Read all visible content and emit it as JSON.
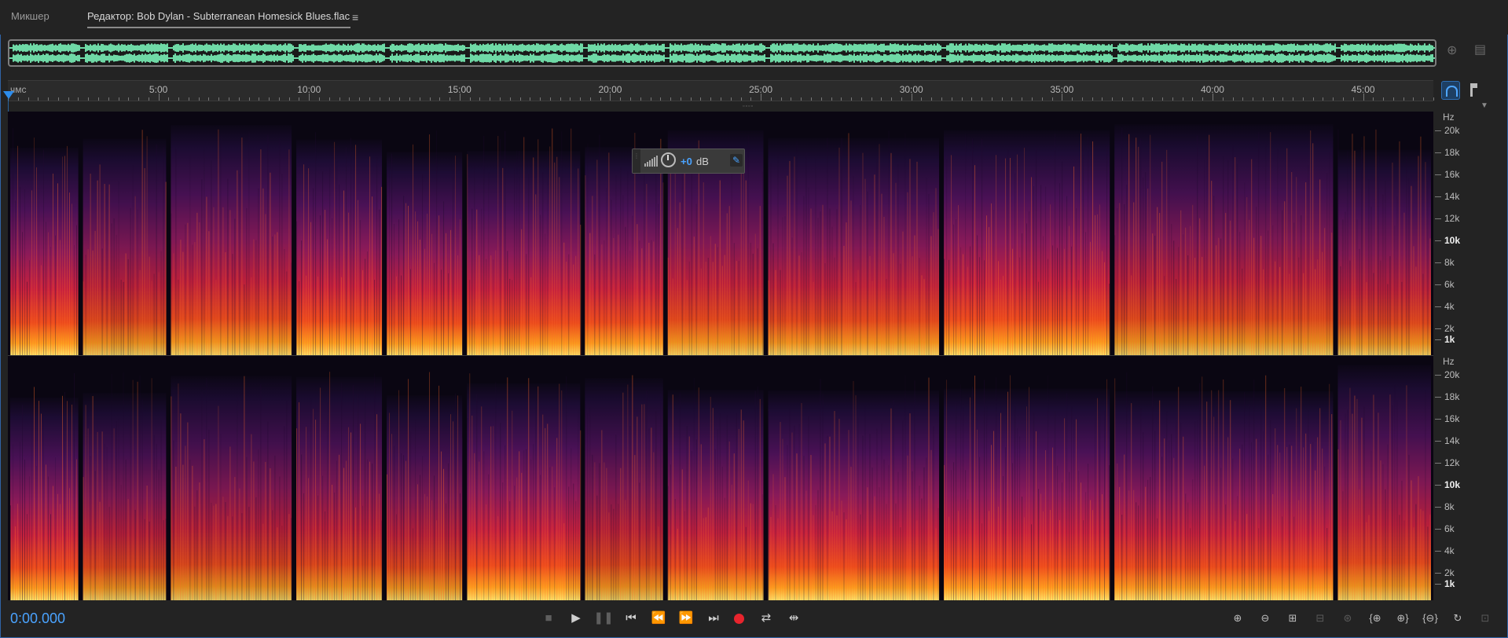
{
  "tabs": [
    {
      "label": "Микшер",
      "active": false
    },
    {
      "label": "Редактор: Bob Dylan - Subterranean Homesick Blues.flac",
      "active": true
    }
  ],
  "tab_menu_icon": "hamburger-menu-icon",
  "ruler": {
    "unit": "чмс",
    "ticks": [
      "5:00",
      "10:00",
      "15:00",
      "20:00",
      "25:00",
      "30:00",
      "35:00",
      "40:00",
      "45:00"
    ],
    "tick_seconds": [
      300,
      600,
      900,
      1200,
      1500,
      1800,
      2100,
      2400,
      2700
    ],
    "view_end_seconds": 2840
  },
  "hud": {
    "value": "+0",
    "unit": "dB"
  },
  "frequency_axis": {
    "title": "Hz",
    "labels": [
      "20k",
      "18k",
      "16k",
      "14k",
      "12k",
      "10k",
      "8k",
      "6k",
      "4k",
      "2k",
      "1k"
    ],
    "bold": [
      "10k",
      "1k"
    ]
  },
  "timecode": "0:00.000",
  "transport": {
    "buttons": [
      "stop-icon",
      "play-icon",
      "pause-icon",
      "go-to-start-icon",
      "rewind-icon",
      "fast-forward-icon",
      "go-to-end-icon",
      "record-icon",
      "loop-icon",
      "skip-selection-icon"
    ]
  },
  "zoom_controls": [
    "zoom-in-amplitude-icon",
    "zoom-out-amplitude-icon",
    "zoom-selection-icon",
    "zoom-out-full-icon",
    "zoom-in-spectral-icon",
    "zoom-in-start-icon",
    "zoom-in-end-icon",
    "zoom-out-center-icon",
    "zoom-reset-icon",
    "zoom-full-icon"
  ],
  "colors": {
    "waveform": "#6fd9a6",
    "accent": "#2d8ceb",
    "timecode": "#4aa3ff",
    "record": "#e8242d",
    "background": "#232323"
  },
  "song_gaps_seconds": [
    0,
    145,
    320,
    570,
    750,
    910,
    1145,
    1310,
    1510,
    1860,
    2200,
    2645,
    2840
  ]
}
